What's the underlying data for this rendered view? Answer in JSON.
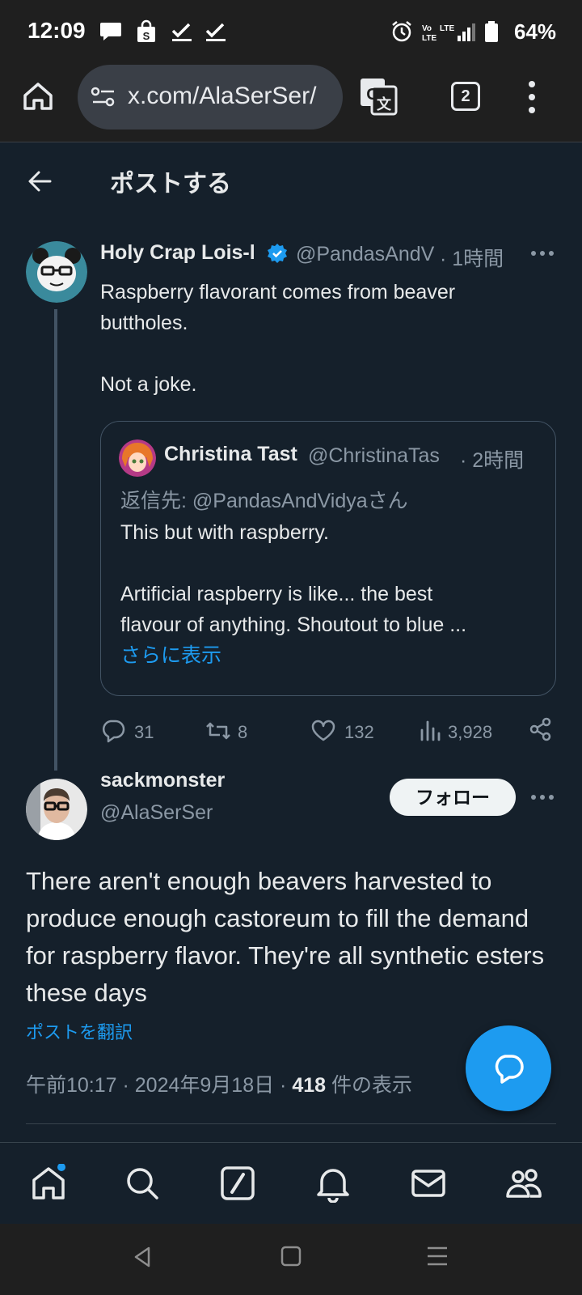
{
  "status_bar": {
    "time": "12:09",
    "battery": "64%"
  },
  "browser": {
    "url": "x.com/AlaSerSer/",
    "tab_count": "2"
  },
  "header": {
    "title": "ポストする"
  },
  "parent_tweet": {
    "author_name": "Holy Crap Lois-l",
    "handle": "@PandasAndV",
    "time": "· 1時間",
    "text": "Raspberry flavorant comes from beaver\nbuttholes.\n\nNot a joke.",
    "quote": {
      "author_name": "Christina Tast",
      "handle": "@ChristinaTas",
      "time": "· 2時間",
      "reply_to": "返信先: @PandasAndVidyaさん",
      "text": "This but with raspberry.\n\nArtificial raspberry is like... the best\nflavour of anything. Shoutout to blue ...",
      "show_more": "さらに表示"
    },
    "stats": {
      "replies": "31",
      "reposts": "8",
      "likes": "132",
      "views": "3,928"
    }
  },
  "main_tweet": {
    "author_name": "sackmonster",
    "handle": "@AlaSerSer",
    "follow_label": "フォロー",
    "text": "There aren't enough beavers harvested to produce enough castoreum to fill the demand for raspberry flavor. They're all synthetic esters these days",
    "translate_label": "ポストを翻訳",
    "timestamp": "午前10:17 · 2024年9月18日 ·",
    "view_count": "418",
    "view_suffix": "件の表示"
  },
  "colors": {
    "background": "#15202b",
    "accent": "#1d9bf0",
    "verified": "#1d9bf0"
  }
}
